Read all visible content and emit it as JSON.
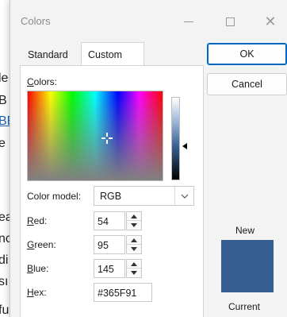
{
  "background_doc": {
    "fragments": [
      "le",
      "B",
      "BE",
      "e",
      "ea",
      "nc",
      "di",
      "sı",
      "fu"
    ]
  },
  "window": {
    "title": "Colors",
    "close_glyph": "✕"
  },
  "tabs": [
    {
      "label": "Standard",
      "active": false
    },
    {
      "label": "Custom",
      "active": true
    }
  ],
  "custom": {
    "colors_label": "Colors:",
    "color_model_label": "Color model:",
    "color_model_value": "RGB",
    "red_label": "Red:",
    "red_value": "54",
    "green_label": "Green:",
    "green_value": "95",
    "blue_label": "Blue:",
    "blue_value": "145",
    "hex_label": "Hex:",
    "hex_value": "#365F91"
  },
  "buttons": {
    "ok": "OK",
    "cancel": "Cancel"
  },
  "preview": {
    "new_label": "New",
    "current_label": "Current",
    "new_color": "#365f91",
    "current_color": "#365f91"
  },
  "colors": {
    "accent": "#0067c0",
    "dialog_bg": "#f3f3f3"
  }
}
